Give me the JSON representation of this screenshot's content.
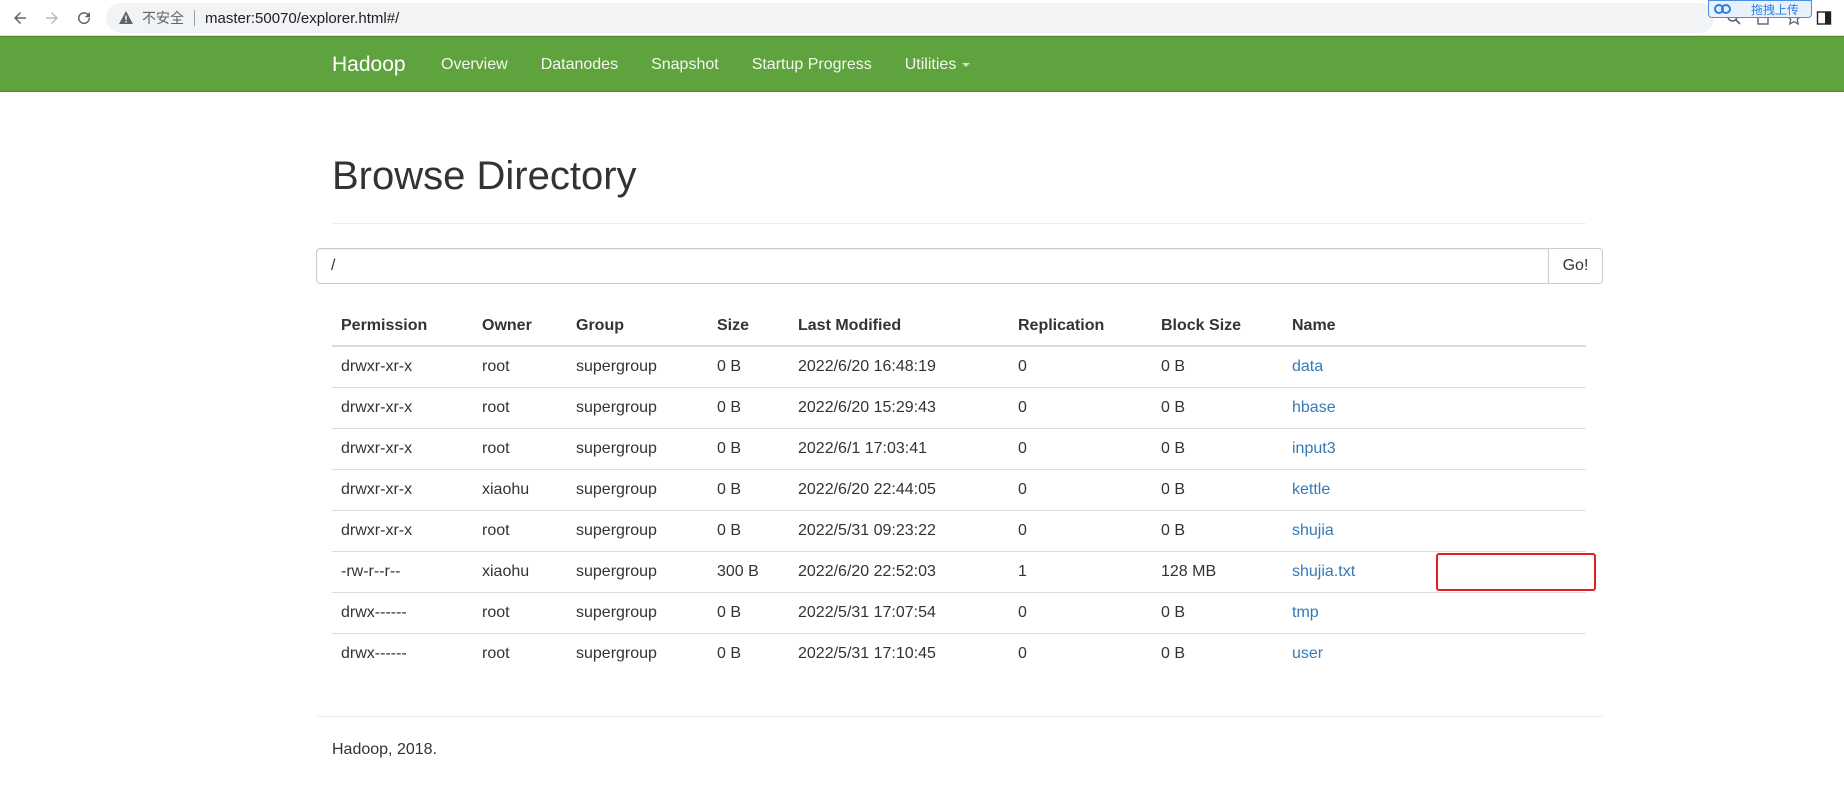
{
  "browser": {
    "security_label": "不安全",
    "url": "master:50070/explorer.html#/",
    "upload_badge": "拖拽上传"
  },
  "navbar": {
    "brand": "Hadoop",
    "links": [
      "Overview",
      "Datanodes",
      "Snapshot",
      "Startup Progress",
      "Utilities"
    ]
  },
  "page": {
    "title": "Browse Directory",
    "path_value": "/",
    "go_label": "Go!"
  },
  "table": {
    "headers": [
      "Permission",
      "Owner",
      "Group",
      "Size",
      "Last Modified",
      "Replication",
      "Block Size",
      "Name"
    ],
    "rows": [
      [
        "drwxr-xr-x",
        "root",
        "supergroup",
        "0 B",
        "2022/6/20 16:48:19",
        "0",
        "0 B",
        "data"
      ],
      [
        "drwxr-xr-x",
        "root",
        "supergroup",
        "0 B",
        "2022/6/20 15:29:43",
        "0",
        "0 B",
        "hbase"
      ],
      [
        "drwxr-xr-x",
        "root",
        "supergroup",
        "0 B",
        "2022/6/1 17:03:41",
        "0",
        "0 B",
        "input3"
      ],
      [
        "drwxr-xr-x",
        "xiaohu",
        "supergroup",
        "0 B",
        "2022/6/20 22:44:05",
        "0",
        "0 B",
        "kettle"
      ],
      [
        "drwxr-xr-x",
        "root",
        "supergroup",
        "0 B",
        "2022/5/31 09:23:22",
        "0",
        "0 B",
        "shujia"
      ],
      [
        "-rw-r--r--",
        "xiaohu",
        "supergroup",
        "300 B",
        "2022/6/20 22:52:03",
        "1",
        "128 MB",
        "shujia.txt"
      ],
      [
        "drwx------",
        "root",
        "supergroup",
        "0 B",
        "2022/5/31 17:07:54",
        "0",
        "0 B",
        "tmp"
      ],
      [
        "drwx------",
        "root",
        "supergroup",
        "0 B",
        "2022/5/31 17:10:45",
        "0",
        "0 B",
        "user"
      ]
    ]
  },
  "footer": {
    "text": "Hadoop, 2018."
  },
  "colors": {
    "navbar": "#5fa33e",
    "link": "#337ab7",
    "highlight": "#e02020"
  }
}
